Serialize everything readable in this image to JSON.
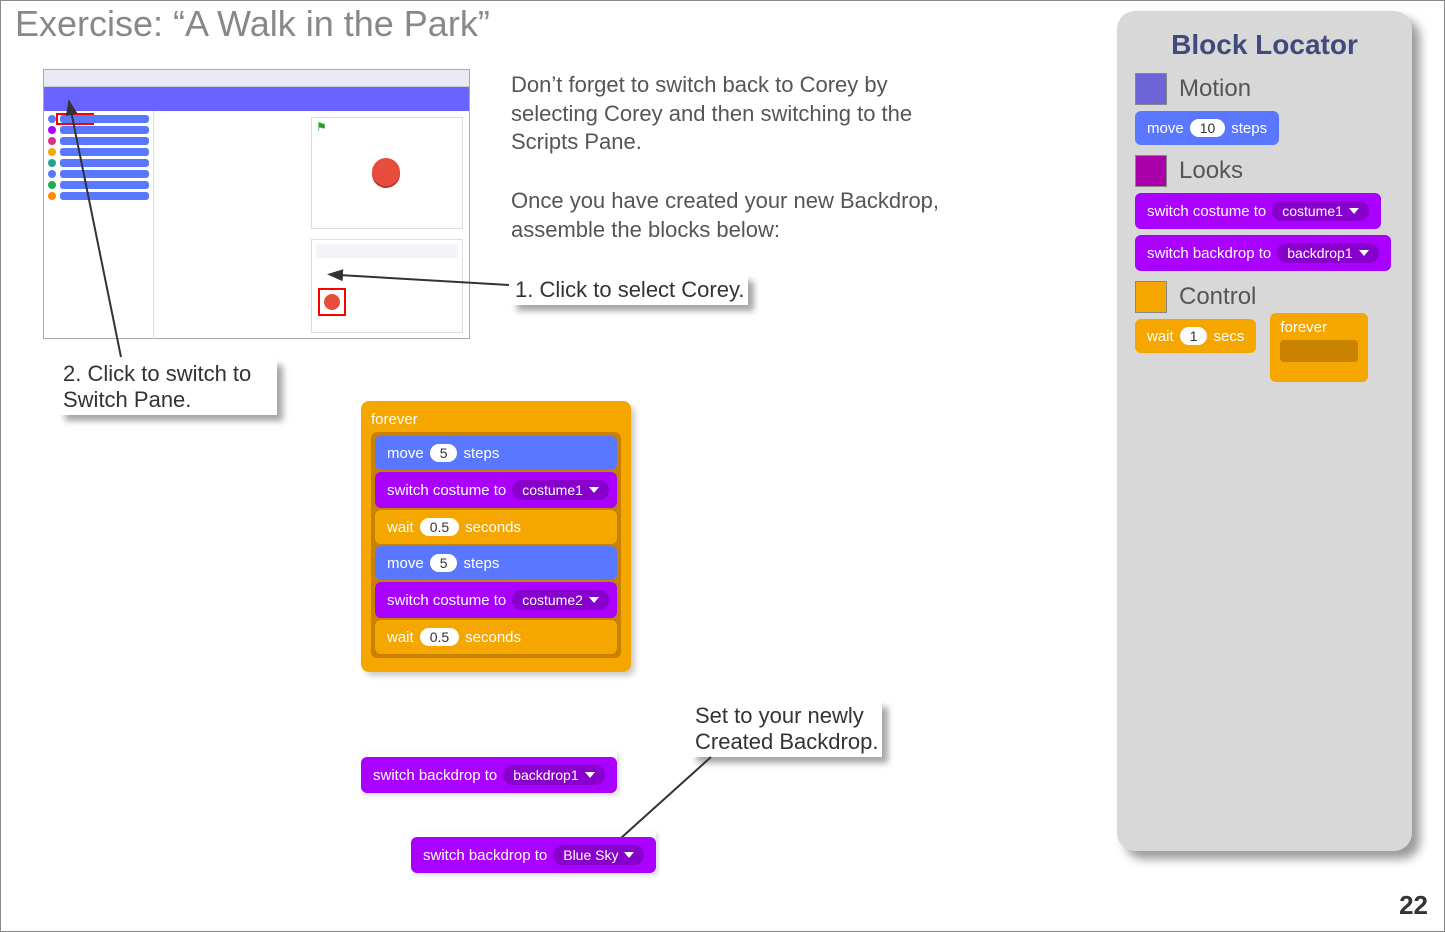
{
  "title": "Exercise: “A Walk in the Park”",
  "para1": "Don’t forget to switch back to Corey by selecting Corey and then switching to the Scripts Pane.",
  "para2": "Once you have created your new Backdrop, assemble the blocks below:",
  "callout1": "1. Click to select Corey.",
  "callout2": "2. Click to switch to Switch Pane.",
  "callout3_line1": "Set to your newly",
  "callout3_line2": "Created Backdrop.",
  "page_num": "22",
  "sidebar": {
    "title": "Block Locator",
    "cats": {
      "motion": "Motion",
      "looks": "Looks",
      "control": "Control"
    },
    "motion_block": {
      "pre": "move",
      "val": "10",
      "post": "steps"
    },
    "looks_block1": {
      "pre": "switch costume to",
      "val": "costume1"
    },
    "looks_block2": {
      "pre": "switch backdrop to",
      "val": "backdrop1"
    },
    "control_wait": {
      "pre": "wait",
      "val": "1",
      "post": "secs"
    },
    "control_forever": "forever"
  },
  "stack": {
    "forever": "forever",
    "b1": {
      "pre": "move",
      "val": "5",
      "post": "steps"
    },
    "b2": {
      "pre": "switch costume to",
      "val": "costume1"
    },
    "b3": {
      "pre": "wait",
      "val": "0.5",
      "post": "seconds"
    },
    "b4": {
      "pre": "move",
      "val": "5",
      "post": "steps"
    },
    "b5": {
      "pre": "switch costume to",
      "val": "costume2"
    },
    "b6": {
      "pre": "wait",
      "val": "0.5",
      "post": "seconds"
    }
  },
  "single1": {
    "pre": "switch backdrop to",
    "val": "backdrop1"
  },
  "single2": {
    "pre": "switch backdrop to",
    "val": "Blue Sky"
  },
  "colors": {
    "motion": "#6b63d6",
    "looks": "#aa00aa",
    "control": "#f5a700"
  }
}
